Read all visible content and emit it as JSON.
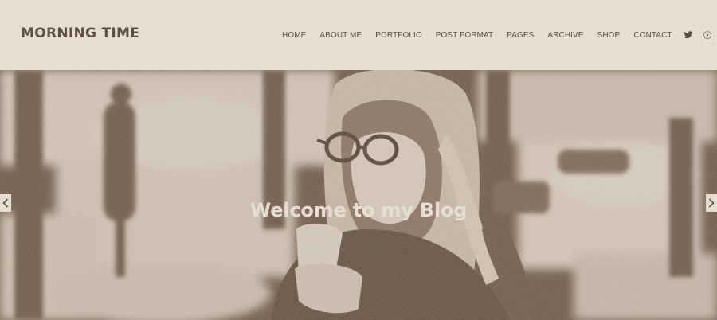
{
  "site": {
    "logo": "MORNING TIME"
  },
  "nav": {
    "items": [
      {
        "label": "HOME"
      },
      {
        "label": "ABOUT ME"
      },
      {
        "label": "PORTFOLIO"
      },
      {
        "label": "POST FORMAT"
      },
      {
        "label": "PAGES"
      },
      {
        "label": "ARCHIVE"
      },
      {
        "label": "SHOP"
      },
      {
        "label": "CONTACT"
      }
    ],
    "social": [
      "twitter-icon",
      "google-plus-icon",
      "facebook-icon"
    ]
  },
  "hero": {
    "title": "Welcome to my Blog",
    "prev_icon": "chevron-left-icon",
    "next_icon": "chevron-right-icon"
  },
  "colors": {
    "background": "#e6ddd3",
    "text": "#5e4f43",
    "hero_dark": "#6b5848"
  }
}
